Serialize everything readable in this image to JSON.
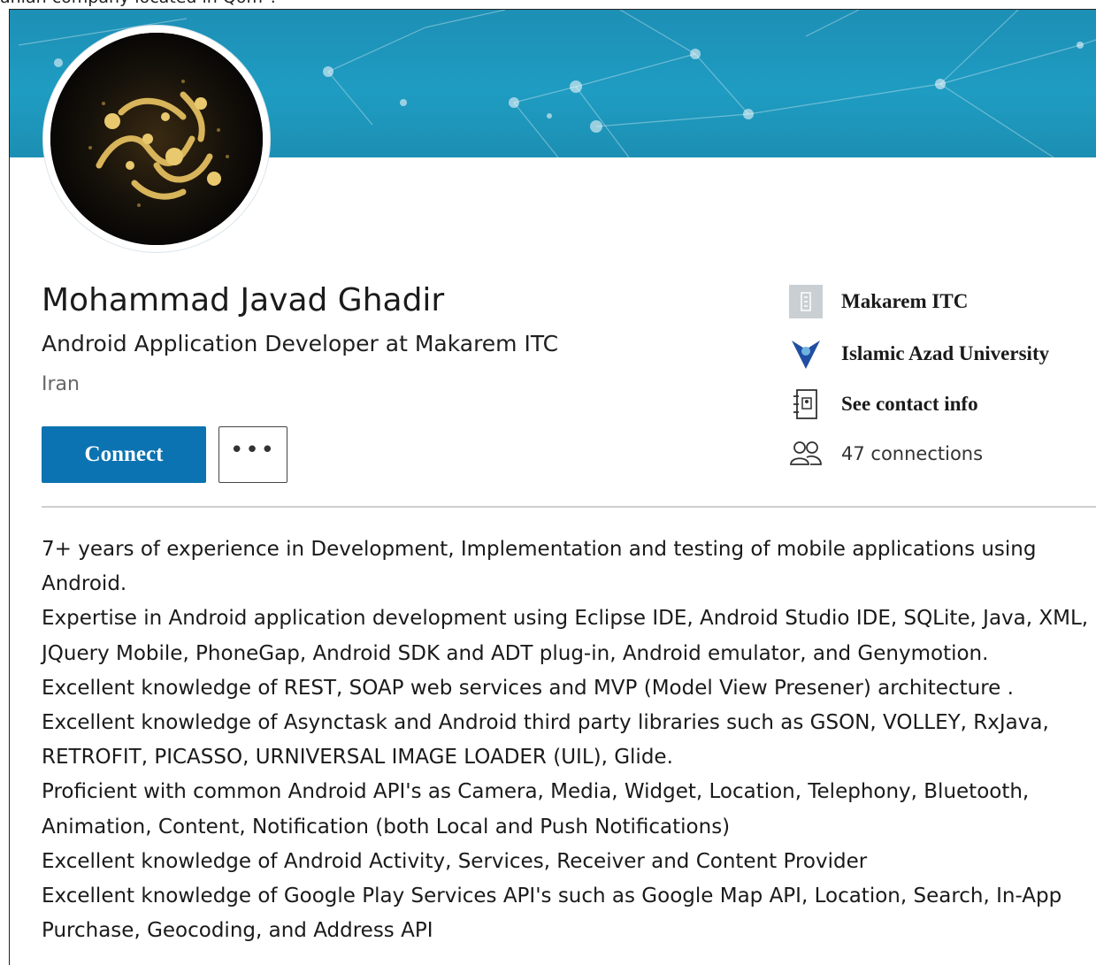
{
  "top_snippet": "anian company located in Qom\".",
  "profile": {
    "name": "Mohammad Javad Ghadir",
    "headline": "Android Application Developer at Makarem ITC",
    "location": "Iran"
  },
  "actions": {
    "connect_label": "Connect",
    "more_label": "•••"
  },
  "side_info": {
    "company": "Makarem ITC",
    "school": "Islamic Azad University",
    "contact": "See contact info",
    "connections": "47 connections"
  },
  "summary": [
    "7+ years of experience in Development, Implementation and testing of mobile applications using Android.",
    "Expertise in Android application development using Eclipse IDE, Android Studio IDE, SQLite, Java, XML, JQuery Mobile, PhoneGap, Android SDK and ADT plug-in, Android emulator, and Genymotion.",
    "Excellent knowledge of REST, SOAP web services and MVP (Model View Presener) architecture .",
    "Excellent knowledge of Asynctask and Android third party libraries such as GSON, VOLLEY, RxJava, RETROFIT, PICASSO, URNIVERSAL IMAGE LOADER (UIL), Glide.",
    "Proficient with common Android API's as Camera, Media, Widget, Location, Telephony, Bluetooth, Animation, Content, Notification (both Local and Push Notifications)",
    "Excellent knowledge of Android Activity, Services, Receiver and Content Provider",
    "Excellent knowledge of Google Play Services API's such as Google Map API, Location, Search, In-App Purchase, Geocoding, and Address API"
  ],
  "colors": {
    "banner": "#1f9cc2",
    "connect_button": "#0b73b1",
    "company_logo": "#c9cfd3",
    "school_logo": "#1f4ea3"
  },
  "icons": {
    "company": "building-icon",
    "school": "university-logo-icon",
    "contact": "contact-book-icon",
    "connections": "people-icon",
    "more": "more-dots-icon"
  }
}
